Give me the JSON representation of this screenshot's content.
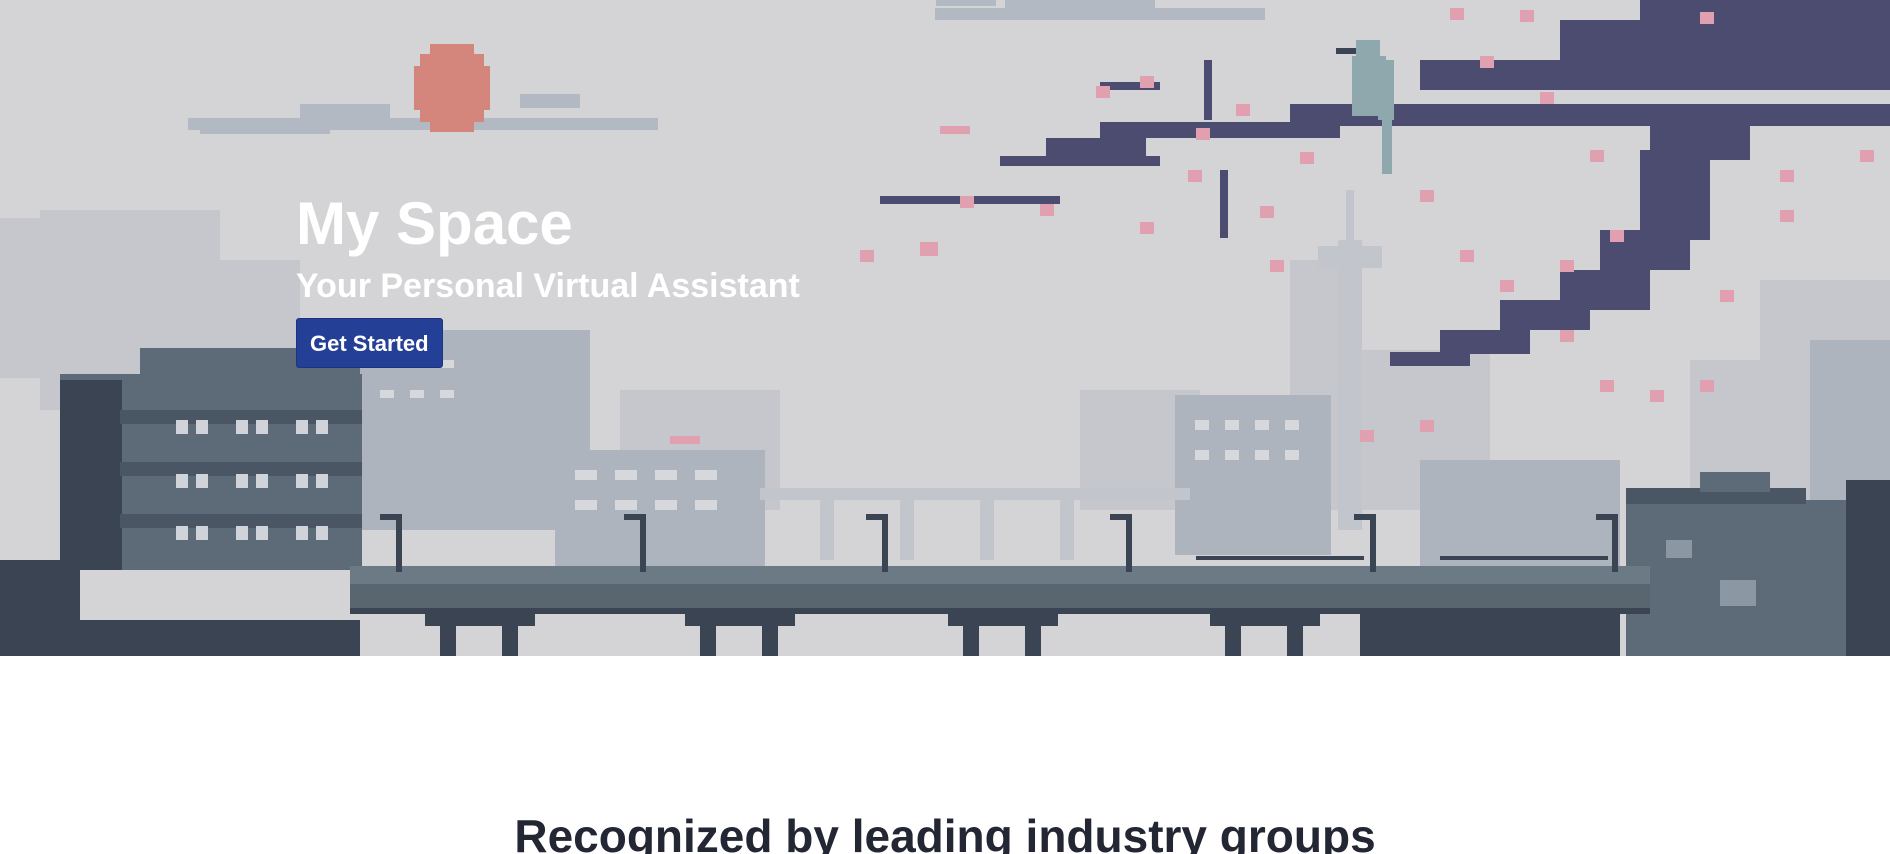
{
  "hero": {
    "title": "My Space",
    "subtitle": "Your Personal Virtual Assistant",
    "cta_label": "Get Started",
    "background_scene": "pixel-art-city-skyline-with-cherry-blossom-branch"
  },
  "section": {
    "heading": "Recognized by leading industry groups"
  },
  "colors": {
    "sky": "#d4d4d6",
    "sun": "#d4857c",
    "cloud": "#b0b6c0",
    "building_far": "#bfc2c9",
    "building_mid": "#a9b0ba",
    "building_near": "#5d6b78",
    "building_dark": "#3a4452",
    "branch": "#4c4c70",
    "blossom": "#e0a0b0",
    "bird": "#8fa8ad",
    "button": "#243f96",
    "heading_text": "#232733",
    "hero_text": "#ffffff"
  }
}
